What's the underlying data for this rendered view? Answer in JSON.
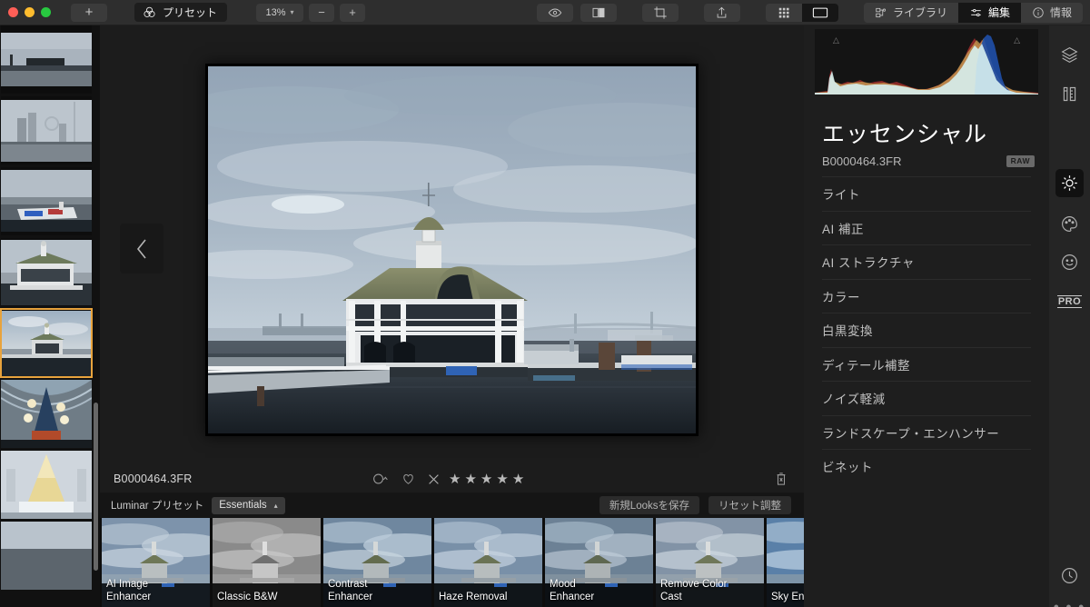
{
  "app": {
    "title": "Luminar",
    "window_controls": [
      "close",
      "minimize",
      "maximize"
    ]
  },
  "toolbar": {
    "add_label": "+",
    "preset_label": "プリセット",
    "preset_icon": "venn-circles-icon",
    "zoom_value": "13%",
    "zoom_out_label": "−",
    "zoom_in_label": "+",
    "icons": {
      "before_after": "eye-icon",
      "split_view": "split-compare-icon",
      "crop": "crop-icon",
      "share": "share-upload-icon",
      "gallery_grid": "grid-view-icon",
      "single_view": "single-view-icon"
    },
    "tabs": [
      {
        "label": "ライブラリ",
        "icon": "library-icon",
        "active": false
      },
      {
        "label": "編集",
        "icon": "sliders-icon",
        "active": true
      },
      {
        "label": "情報",
        "icon": "info-icon",
        "active": false
      }
    ]
  },
  "filmstrip": {
    "items": [
      {
        "name": "harbor-skyline-1",
        "selected": false
      },
      {
        "name": "city-skyline-ferris-wheel",
        "selected": false
      },
      {
        "name": "boat-dock",
        "selected": false
      },
      {
        "name": "pier-building-close",
        "selected": false
      },
      {
        "name": "pier-building-wide",
        "selected": true
      },
      {
        "name": "christmas-tree-atrium",
        "selected": false
      },
      {
        "name": "christmas-tree-white",
        "selected": false
      },
      {
        "name": "extra-thumb",
        "selected": false
      }
    ],
    "scrollbar": true
  },
  "canvas": {
    "prev_button_icon": "chevron-left-icon",
    "image_alt": "pier-building-photo"
  },
  "infobar": {
    "filename": "B0000464.3FR",
    "icons": {
      "color_label": "color-label-icon",
      "favorite": "heart-icon",
      "reject": "reject-x-icon",
      "delete": "trash-icon"
    },
    "stars": 5,
    "stars_filled": 0
  },
  "preset_header": {
    "label": "Luminar プリセット",
    "collection": "Essentials",
    "collection_chevron": "chevron-up-icon",
    "save_looks_label": "新規Looksを保存",
    "reset_label": "リセット調整"
  },
  "presets": [
    {
      "label": "AI Image\nEnhancer",
      "line1": "AI Image",
      "line2": "Enhancer",
      "tone": "color"
    },
    {
      "label": "Classic B&W",
      "line1": "",
      "line2": "Classic B&W",
      "tone": "bw"
    },
    {
      "label": "Contrast\nEnhancer",
      "line1": "Contrast",
      "line2": "Enhancer",
      "tone": "contrast"
    },
    {
      "label": "Haze Removal",
      "line1": "",
      "line2": "Haze Removal",
      "tone": "haze"
    },
    {
      "label": "Mood\nEnhancer",
      "line1": "Mood",
      "line2": "Enhancer",
      "tone": "mood"
    },
    {
      "label": "Remove Color\nCast",
      "line1": "Remove Color",
      "line2": "Cast",
      "tone": "cast"
    },
    {
      "label": "Sky Enha",
      "line1": "",
      "line2": "Sky Enha",
      "tone": "sky"
    }
  ],
  "right_panel": {
    "histogram_title": "histogram",
    "clip_left_icon": "triangle-warning-left",
    "clip_right_icon": "triangle-warning-right",
    "title": "エッセンシャル",
    "filename": "B0000464.3FR",
    "format_badge": "RAW",
    "tools": [
      "ライト",
      "AI 補正",
      "AI ストラクチャ",
      "カラー",
      "白黒変換",
      "ディテール補整",
      "ノイズ軽減",
      "ランドスケープ・エンハンサー",
      "ビネット"
    ]
  },
  "rail": {
    "items": [
      {
        "name": "layers-icon",
        "active": false
      },
      {
        "name": "canvas-tools-icon",
        "active": false
      },
      {
        "name": "essentials-sun-icon",
        "active": true
      },
      {
        "name": "creative-palette-icon",
        "active": false
      },
      {
        "name": "portrait-smiley-icon",
        "active": false
      },
      {
        "name": "pro-icon",
        "label": "PRO",
        "active": false
      },
      {
        "name": "history-clock-icon",
        "active": false
      },
      {
        "name": "more-dots-icon",
        "label": "● ● ●",
        "active": false
      }
    ]
  },
  "colors": {
    "accent_selected": "#e8a33d",
    "toolbar_bg": "#2e2e2e",
    "panel_bg": "#1e1e1e",
    "canvas_bg": "#1c1c1c",
    "rail_bg": "#252525"
  }
}
